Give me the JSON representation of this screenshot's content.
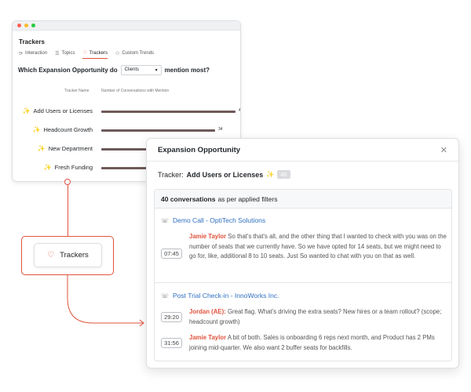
{
  "back_window": {
    "title": "Trackers",
    "tabs": [
      {
        "icon": "interaction-icon",
        "label": "Interaction"
      },
      {
        "icon": "topics-icon",
        "label": "Topics"
      },
      {
        "icon": "trackers-icon",
        "label": "Trackers",
        "active": true
      },
      {
        "icon": "custom-trends-icon",
        "label": "Custom Trends"
      }
    ],
    "question_prefix": "Which Expansion Opportunity do",
    "select_value": "Clients",
    "question_suffix": "mention most?",
    "col_tracker_name": "Tracker Name",
    "col_conversations": "Number of Conversations with Mention",
    "rows": [
      {
        "name": "Add Users or Licenses",
        "value": 40,
        "value_label": "40"
      },
      {
        "name": "Headcount Growth",
        "value": 34,
        "value_label": "34"
      },
      {
        "name": "New Department",
        "value": 30,
        "value_label": ""
      },
      {
        "name": "Fresh Funding",
        "value": 30,
        "value_label": ""
      }
    ],
    "max_value": 40
  },
  "trackers_button": {
    "label": "Trackers"
  },
  "panel": {
    "title": "Expansion Opportunity",
    "tracker_label": "Tracker:",
    "tracker_name": "Add Users or Licenses",
    "tracker_count": "40",
    "conv_count": "40 conversations",
    "conv_suffix": "as per applied filters",
    "calls": [
      {
        "title": "Demo Call - OptiTech Solutions",
        "snippets": [
          {
            "time": "07:45",
            "speaker": "Jamie Taylor",
            "text": " So that's that's all, and the other thing that I wanted to check with you was on the number of seats that we currently have. So we have opted for 14 seats, but we might need to go for, like, additional 8 to 10 seats. Just So wanted to chat with you on that as well."
          }
        ]
      },
      {
        "title": "Post Trial Check-in - InnoWorks Inc.",
        "snippets": [
          {
            "time": "29:20",
            "speaker": "Jordan (AE):",
            "text": " Great flag. What's driving the extra seats? New hires or a team rollout? (scope; headcount growth)"
          },
          {
            "time": "31:56",
            "speaker": "Jamie Taylor",
            "text": " A bit of both. Sales is onboarding 6 reps next month, and Product has 2 PMs joining mid-quarter. We also want 2 buffer seats for backfills."
          }
        ]
      }
    ]
  },
  "colors": {
    "accent": "#e0533d",
    "bar": "#6e5a59",
    "link": "#2f6fc1",
    "sparkle": "#e8b730"
  }
}
